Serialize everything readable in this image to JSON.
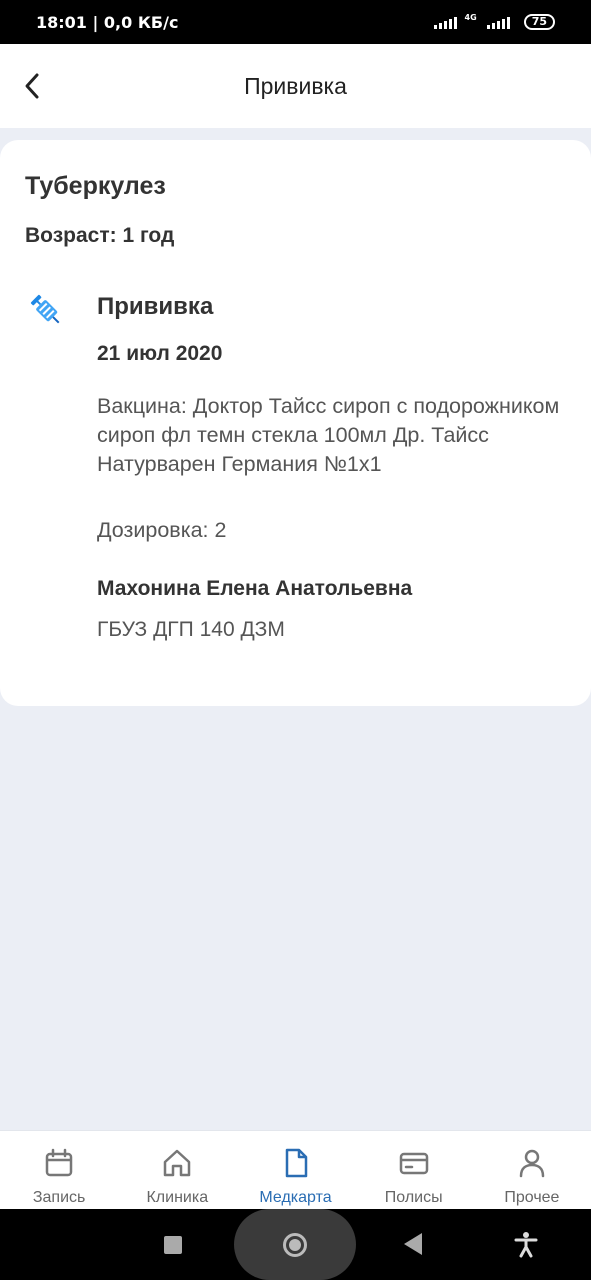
{
  "status_bar": {
    "time_speed": "18:01 | 0,0 КБ/с",
    "network_label": "4G",
    "battery": "75"
  },
  "header": {
    "title": "Прививка",
    "back_icon": "chevron-left-icon"
  },
  "card": {
    "disease": "Туберкулез",
    "age": "Возраст: 1 год",
    "entry": {
      "icon": "syringe-icon",
      "title": "Прививка",
      "date": "21 июл 2020",
      "vaccine": "Вакцина: Доктор Тайсс сироп с подорожником сироп фл темн стекла 100мл Др. Тайсс Натурварен Германия №1х1",
      "dosage": "Дозировка: 2",
      "doctor": "Махонина Елена Анатольевна",
      "clinic": "ГБУЗ ДГП 140 ДЗМ"
    }
  },
  "bottom_nav": {
    "active_color": "#2a6db3",
    "inactive_color": "#666666",
    "items": [
      {
        "label": "Запись",
        "icon": "calendar-icon"
      },
      {
        "label": "Клиника",
        "icon": "home-icon"
      },
      {
        "label": "Медкарта",
        "icon": "document-icon",
        "active": true
      },
      {
        "label": "Полисы",
        "icon": "card-icon"
      },
      {
        "label": "Прочее",
        "icon": "person-icon"
      }
    ]
  }
}
